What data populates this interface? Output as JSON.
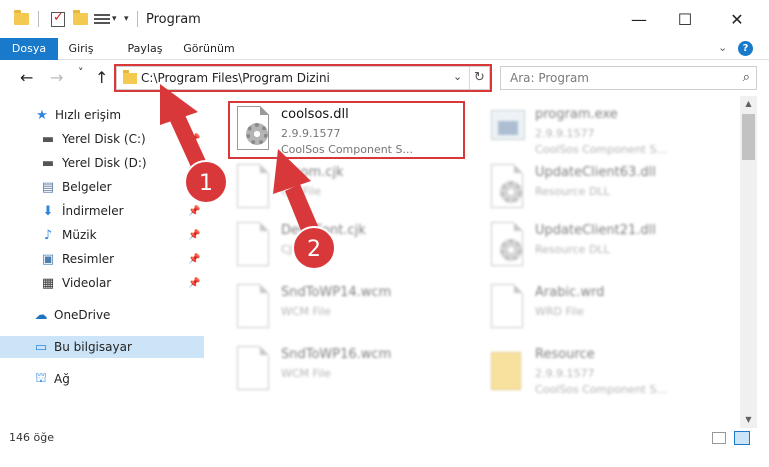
{
  "window": {
    "title": "Program",
    "controls": {
      "minimize": "—",
      "maximize": "☐",
      "close": "✕"
    }
  },
  "ribbon": {
    "tabs": [
      "Dosya",
      "Giriş",
      "Paylaş",
      "Görünüm"
    ],
    "collapse_icon": "chevron-down-icon",
    "help_label": "?"
  },
  "nav": {
    "back_icon": "←",
    "forward_icon": "→",
    "recent_icon": "˅",
    "up_icon": "↑",
    "address": "C:\\Program Files\\Program Dizini",
    "refresh_icon": "↻",
    "dropdown_icon": "⌄",
    "search_placeholder": "Ara: Program",
    "search_icon": "⌕"
  },
  "sidebar": {
    "items": [
      {
        "label": "Hızlı erişim",
        "icon": "star-icon",
        "glyph": "★",
        "color": "#2e86de",
        "pinned": false
      },
      {
        "label": "Yerel Disk (C:)",
        "icon": "drive-icon",
        "glyph": "▬",
        "color": "#555555",
        "pinned": true
      },
      {
        "label": "Yerel Disk (D:)",
        "icon": "drive-icon",
        "glyph": "▬",
        "color": "#555555",
        "pinned": true
      },
      {
        "label": "Belgeler",
        "icon": "documents-icon",
        "glyph": "▤",
        "color": "#5a7aa0",
        "pinned": true
      },
      {
        "label": "İndirmeler",
        "icon": "download-icon",
        "glyph": "⬇",
        "color": "#2e86de",
        "pinned": true
      },
      {
        "label": "Müzik",
        "icon": "music-icon",
        "glyph": "♪",
        "color": "#2e86de",
        "pinned": true
      },
      {
        "label": "Resimler",
        "icon": "pictures-icon",
        "glyph": "▣",
        "color": "#4a7fb0",
        "pinned": true
      },
      {
        "label": "Videolar",
        "icon": "video-icon",
        "glyph": "▦",
        "color": "#333333",
        "pinned": true
      },
      {
        "label": "OneDrive",
        "icon": "cloud-icon",
        "glyph": "☁",
        "color": "#1e73be",
        "pinned": false
      },
      {
        "label": "Bu bilgisayar",
        "icon": "computer-icon",
        "glyph": "▭",
        "color": "#2e86de",
        "pinned": false
      },
      {
        "label": "Ağ",
        "icon": "network-icon",
        "glyph": "⛫",
        "color": "#2e86de",
        "pinned": false
      }
    ],
    "pin_glyph": "📌"
  },
  "files": [
    {
      "name": "coolsos.dll",
      "line1": "2.9.9.1577",
      "line2": "CoolSos Component S...",
      "kind": "dll",
      "blurred": false
    },
    {
      "name": "program.exe",
      "line1": "2.9.9.1577",
      "line2": "CoolSos Component S...",
      "kind": "exe",
      "blurred": true
    },
    {
      "name": "...com.cjk",
      "line1": "CJK File",
      "line2": "",
      "kind": "doc",
      "blurred": true
    },
    {
      "name": "UpdateClient63.dll",
      "line1": "Resource DLL",
      "line2": "",
      "kind": "dll",
      "blurred": true
    },
    {
      "name": "Def...Font.cjk",
      "line1": "CJK File",
      "line2": "",
      "kind": "doc",
      "blurred": true
    },
    {
      "name": "UpdateClient21.dll",
      "line1": "Resource DLL",
      "line2": "",
      "kind": "dll",
      "blurred": true
    },
    {
      "name": "SndToWP14.wcm",
      "line1": "WCM File",
      "line2": "",
      "kind": "doc",
      "blurred": true
    },
    {
      "name": "Arabic.wrd",
      "line1": "WRD File",
      "line2": "",
      "kind": "doc",
      "blurred": true
    },
    {
      "name": "SndToWP16.wcm",
      "line1": "WCM File",
      "line2": "",
      "kind": "doc",
      "blurred": true
    },
    {
      "name": "Resource",
      "line1": "2.9.9.1577",
      "line2": "CoolSos Component S...",
      "kind": "res",
      "blurred": true
    }
  ],
  "status": {
    "count_text": "146 öğe"
  },
  "annotations": {
    "color": "#d9383a",
    "badge_1": "1",
    "badge_2": "2"
  }
}
